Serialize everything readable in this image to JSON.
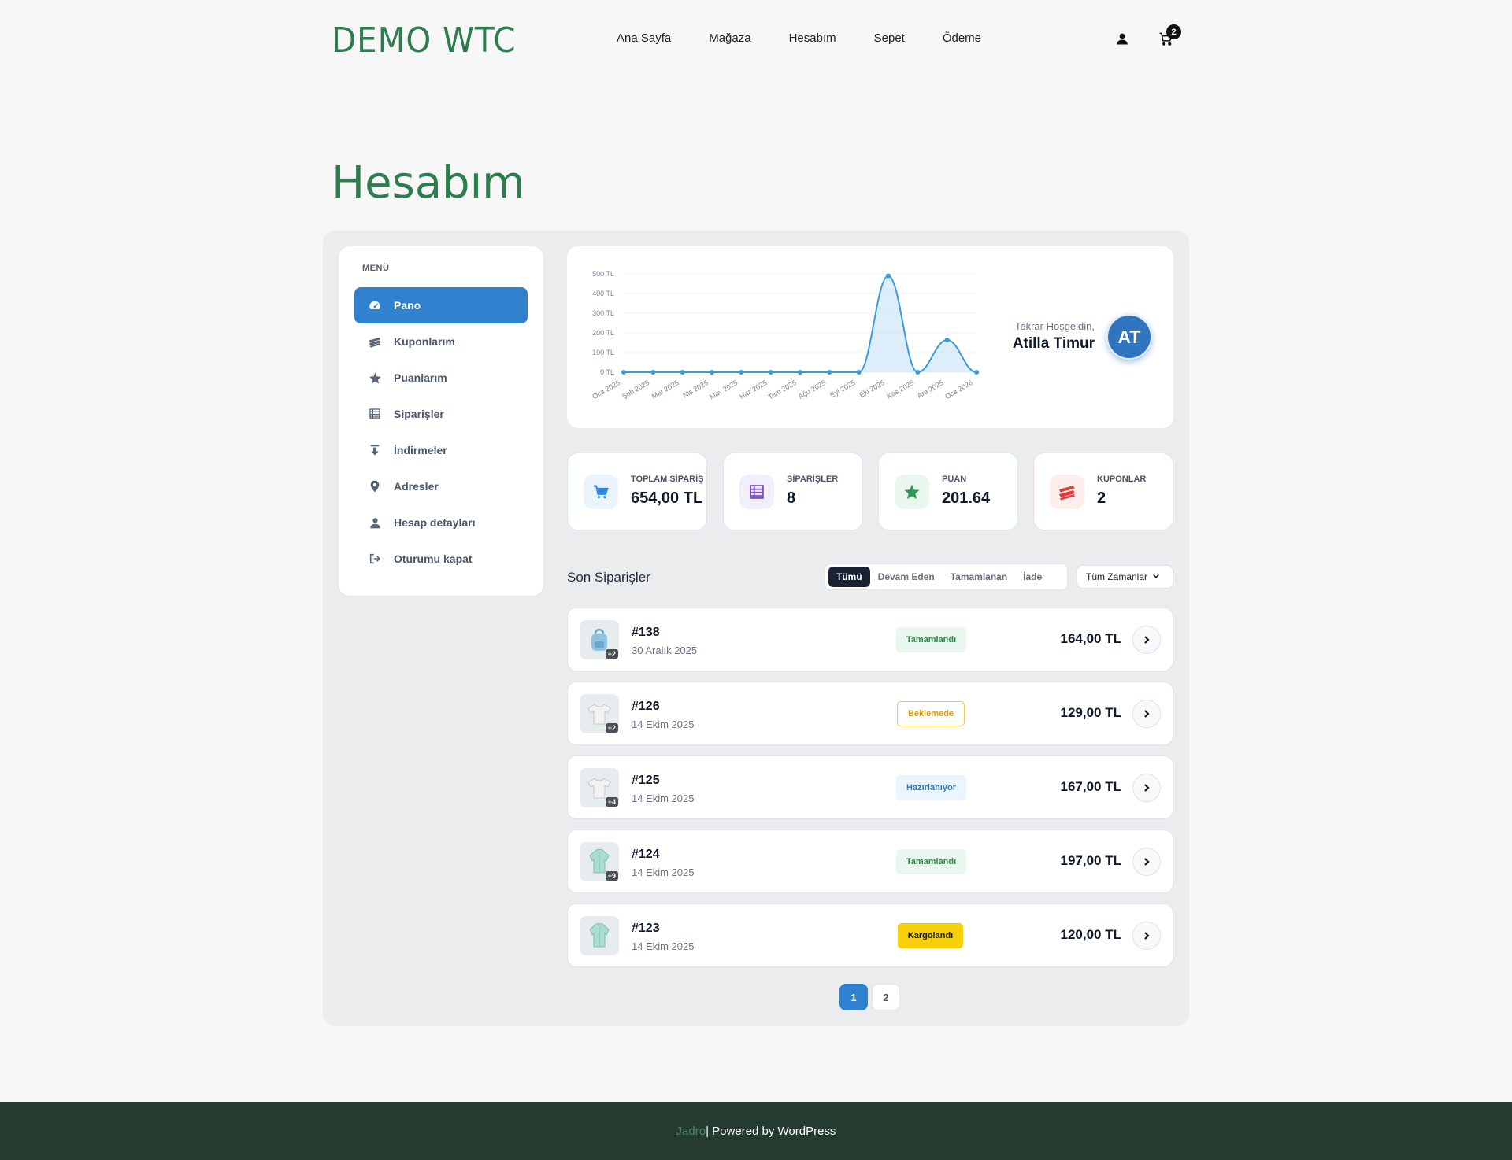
{
  "header": {
    "logo": "DEMO WTC",
    "nav": [
      "Ana Sayfa",
      "Mağaza",
      "Hesabım",
      "Sepet",
      "Ödeme"
    ],
    "cart_count": "2",
    "icons": [
      "user-icon",
      "cart-icon"
    ]
  },
  "page": {
    "title": "Hesabım"
  },
  "sidebar": {
    "title": "MENÜ",
    "items": [
      {
        "label": "Pano",
        "icon": "dashboard-icon",
        "active": true
      },
      {
        "label": "Kuponlarım",
        "icon": "coupons-icon"
      },
      {
        "label": "Puanlarım",
        "icon": "star-icon"
      },
      {
        "label": "Siparişler",
        "icon": "list-icon"
      },
      {
        "label": "İndirmeler",
        "icon": "download-icon"
      },
      {
        "label": "Adresler",
        "icon": "location-icon"
      },
      {
        "label": "Hesap detayları",
        "icon": "user-icon"
      },
      {
        "label": "Oturumu kapat",
        "icon": "logout-icon"
      }
    ]
  },
  "welcome": {
    "greeting": "Tekrar Hoşgeldin,",
    "name": "Atilla Timur",
    "initials": "AT"
  },
  "chart_data": {
    "type": "area",
    "categories": [
      "Oca 2025",
      "Şub 2025",
      "Mar 2025",
      "Nis 2025",
      "May 2025",
      "Haz 2025",
      "Tem 2025",
      "Ağu 2025",
      "Eyl 2025",
      "Eki 2025",
      "Kas 2025",
      "Ara 2025",
      "Oca 2026"
    ],
    "values": [
      0,
      0,
      0,
      0,
      0,
      0,
      0,
      0,
      0,
      490,
      0,
      164,
      0
    ],
    "yticks": [
      "0 TL",
      "100 TL",
      "200 TL",
      "300 TL",
      "400 TL",
      "500 TL"
    ],
    "ylim": [
      0,
      500
    ],
    "color": "#3b9ad9"
  },
  "stats": [
    {
      "label": "TOPLAM SİPARİŞ",
      "value": "654,00 TL",
      "icon": "cart-icon",
      "color": "#2f86d6",
      "bg": "#eaf4fd"
    },
    {
      "label": "SİPARİŞLER",
      "value": "8",
      "icon": "list-icon",
      "color": "#7b4fd1",
      "bg": "#f3eefc"
    },
    {
      "label": "PUAN",
      "value": "201.64",
      "icon": "star-icon",
      "color": "#2f9a5a",
      "bg": "#eaf7ef"
    },
    {
      "label": "KUPONLAR",
      "value": "2",
      "icon": "coupons-icon",
      "color": "#e23b3b",
      "bg": "#fdeeee"
    }
  ],
  "orders_section": {
    "title": "Son Siparişler",
    "tabs": [
      "Tümü",
      "Devam Eden",
      "Tamamlanan",
      "İade"
    ],
    "active_tab": "Tümü",
    "time_filter": "Tüm Zamanlar"
  },
  "orders": [
    {
      "number": "#138",
      "date": "30 Aralık 2025",
      "status": "Tamamlandı",
      "status_type": "green",
      "price": "164,00 TL",
      "extra": "+2",
      "thumb": "backpack"
    },
    {
      "number": "#126",
      "date": "14 Ekim 2025",
      "status": "Beklemede",
      "status_type": "yellow",
      "price": "129,00 TL",
      "extra": "+2",
      "thumb": "tshirt"
    },
    {
      "number": "#125",
      "date": "14 Ekim 2025",
      "status": "Hazırlanıyor",
      "status_type": "blue",
      "price": "167,00 TL",
      "extra": "+4",
      "thumb": "tshirt"
    },
    {
      "number": "#124",
      "date": "14 Ekim 2025",
      "status": "Tamamlandı",
      "status_type": "green",
      "price": "197,00 TL",
      "extra": "+9",
      "thumb": "hoodie"
    },
    {
      "number": "#123",
      "date": "14 Ekim 2025",
      "status": "Kargolandı",
      "status_type": "ship",
      "price": "120,00 TL",
      "extra": "",
      "thumb": "hoodie"
    }
  ],
  "pagination": [
    "1",
    "2"
  ],
  "footer": {
    "link": "Jadro",
    "text": "| Powered by WordPress"
  }
}
